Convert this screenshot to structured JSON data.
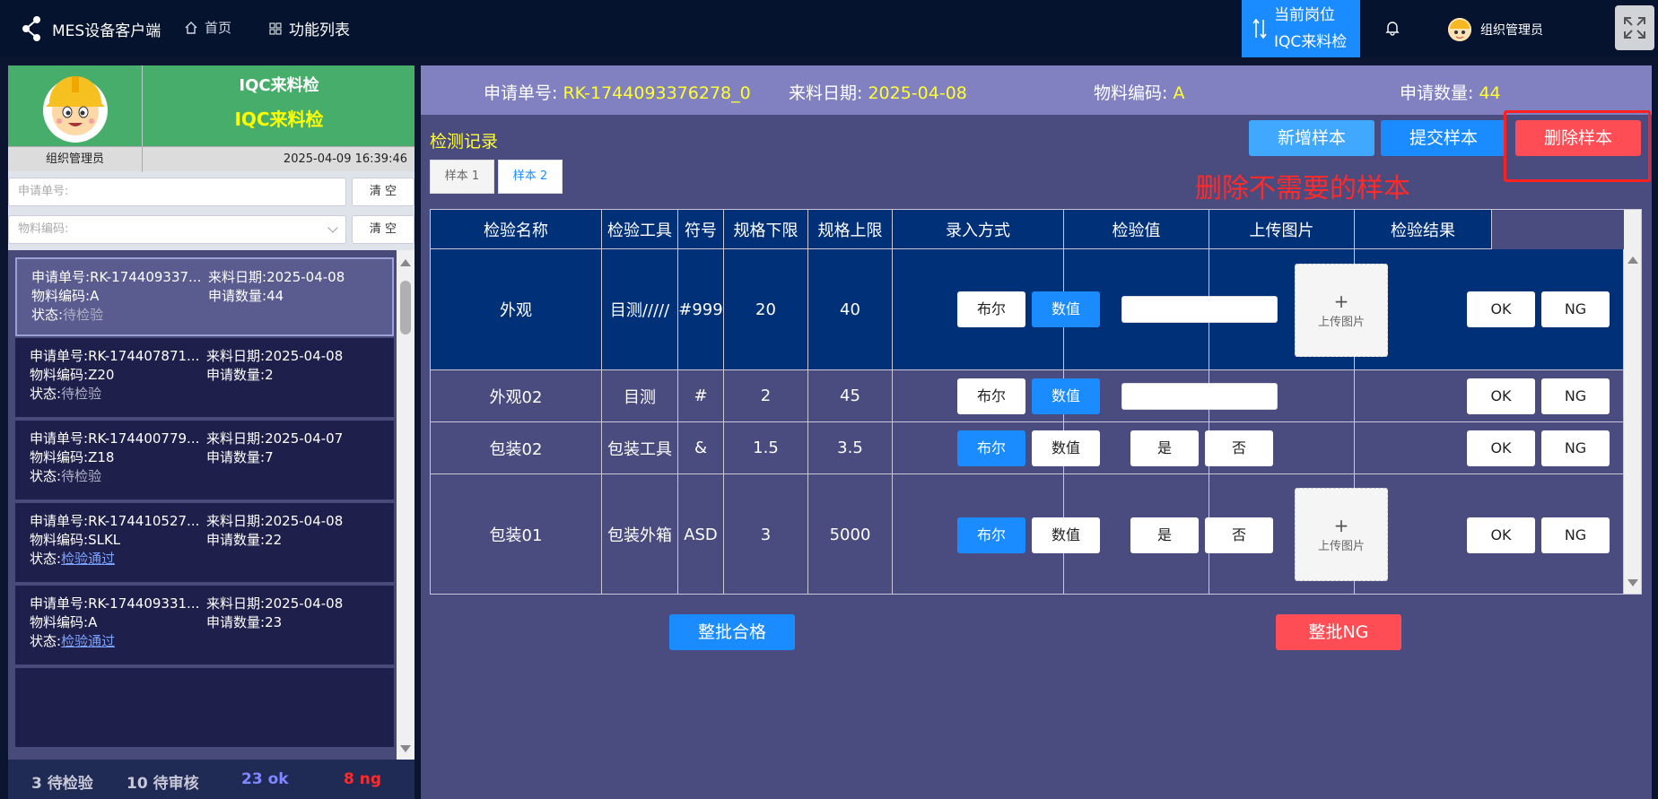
{
  "header": {
    "app_title": "MES设备客户端",
    "home_label": "首页",
    "func_label": "功能列表",
    "post_label": "当前岗位",
    "post_value": "IQC来料检",
    "user_name": "组织管理员"
  },
  "profile": {
    "station_title": "IQC来料检",
    "station_sub": "IQC来料检",
    "user_name": "组织管理员",
    "datetime": "2025-04-09 16:39:46"
  },
  "filters": {
    "apply_no_placeholder": "申请单号:",
    "material_placeholder": "物料编码:",
    "clear_label": "清 空"
  },
  "list": {
    "label_apply": "申请单号:",
    "label_date": "来料日期:",
    "label_code": "物料编码:",
    "label_qty": "申请数量:",
    "label_status": "状态:",
    "items": [
      {
        "apply_no": "RK-174409337...",
        "date": "2025-04-08",
        "code": "A",
        "qty": "44",
        "status": "待检验"
      },
      {
        "apply_no": "RK-174407871...",
        "date": "2025-04-08",
        "code": "Z20",
        "qty": "2",
        "status": "待检验"
      },
      {
        "apply_no": "RK-174400779...",
        "date": "2025-04-07",
        "code": "Z18",
        "qty": "7",
        "status": "待检验"
      },
      {
        "apply_no": "RK-174410527...",
        "date": "2025-04-08",
        "code": "SLKL",
        "qty": "22",
        "status": "检验通过"
      },
      {
        "apply_no": "RK-174409331...",
        "date": "2025-04-08",
        "code": "A",
        "qty": "23",
        "status": "检验通过"
      }
    ]
  },
  "stats": {
    "pending": "3 待检验",
    "review": "10 待审核",
    "ok": "23 ok",
    "ng": "8 ng"
  },
  "info": {
    "apply_label": "申请单号:",
    "apply_value": "RK-1744093376278_0",
    "date_label": "来料日期:",
    "date_value": "2025-04-08",
    "code_label": "物料编码:",
    "code_value": "A",
    "qty_label": "申请数量:",
    "qty_value": "44"
  },
  "records": {
    "title": "检测记录",
    "add_label": "新增样本",
    "submit_label": "提交样本",
    "delete_label": "删除样本",
    "hint": "删除不需要的样本",
    "tabs": [
      "样本 1",
      "样本 2"
    ]
  },
  "table": {
    "headers": [
      "检验名称",
      "检验工具",
      "符号",
      "规格下限",
      "规格上限",
      "录入方式",
      "检验值",
      "上传图片",
      "检验结果"
    ],
    "bool_label": "布尔",
    "num_label": "数值",
    "yes_label": "是",
    "no_label": "否",
    "upload_label": "上传图片",
    "ok_label": "OK",
    "ng_label": "NG",
    "rows": [
      {
        "name": "外观",
        "tool": "目测/////",
        "symbol": "#999",
        "low": "20",
        "high": "40"
      },
      {
        "name": "外观02",
        "tool": "目测",
        "symbol": "#",
        "low": "2",
        "high": "45"
      },
      {
        "name": "包装02",
        "tool": "包装工具",
        "symbol": "&",
        "low": "1.5",
        "high": "3.5"
      },
      {
        "name": "包装01",
        "tool": "包装外箱",
        "symbol": "ASD",
        "low": "3",
        "high": "5000"
      }
    ]
  },
  "batch": {
    "pass_label": "整批合格",
    "ng_label": "整批NG"
  },
  "colors": {
    "accent_blue": "#1a8cff",
    "danger_red": "#ff4d55",
    "profile_green": "#46ad6b",
    "info_yellow": "#ffff33"
  }
}
